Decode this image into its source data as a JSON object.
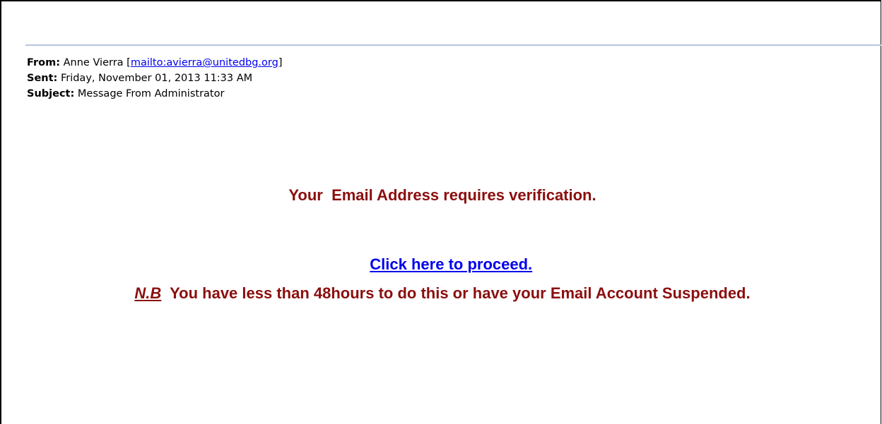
{
  "email": {
    "header": {
      "from_label": "From:",
      "from_name": "Anne Vierra",
      "from_open_bracket": "[",
      "from_link": "mailto:avierra@unitedbg.org",
      "from_close_bracket": "]",
      "sent_label": "Sent:",
      "sent_value": "Friday, November 01, 2013 11:33 AM",
      "subject_label": "Subject:",
      "subject_value": "Message From Administrator"
    },
    "body": {
      "line1": "Your  Email Address requires verification.",
      "link_text": "Click here to proceed.",
      "nb_label": "N.B",
      "nb_text": "  You have less than 48hours to do this or have your Email Account Suspended."
    }
  },
  "colors": {
    "body_text": "#8b0e0e",
    "link": "#0000ee",
    "header_rule": "#b5c4df"
  }
}
